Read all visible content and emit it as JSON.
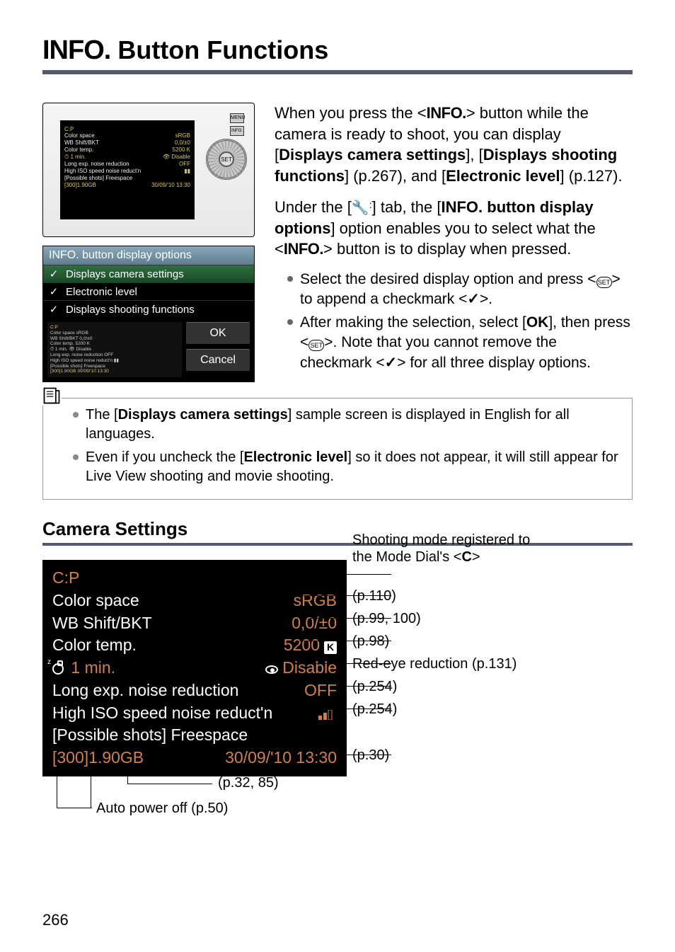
{
  "title_glyph": "INFO.",
  "title_text": "Button Functions",
  "intro": {
    "p1_a": "When you press the <",
    "p1_info": "INFO.",
    "p1_b": "> button while the camera is ready to shoot, you can display [",
    "p1_bold1": "Displays camera settings",
    "p1_c": "], [",
    "p1_bold2": "Displays shooting functions",
    "p1_d": "] (p.267), and [",
    "p1_bold3": "Electronic level",
    "p1_e": "] (p.127).",
    "p2_a": "Under the [",
    "p2_wrench": "🔧",
    "p2_b": "] tab, the [",
    "p2_bold1": "INFO. button display options",
    "p2_c": "] option enables you to select what the <",
    "p2_info": "INFO.",
    "p2_d": "> button is to display when pressed."
  },
  "bullets": [
    {
      "a": "Select the desired display option and press <",
      "mid": "SET",
      "b": "> to append a checkmark <",
      "chk": "✓",
      "c": ">."
    },
    {
      "a": "After making the selection, select [",
      "bold": "OK",
      "b": "], then press <",
      "mid": "SET",
      "c": ">. Note that you cannot remove the checkmark <",
      "chk": "✓",
      "d": "> for all three display options."
    }
  ],
  "camera_lcd": {
    "title": "C:P",
    "rows": [
      [
        "Color space",
        "sRGB"
      ],
      [
        "WB Shift/BKT",
        "0,0/±0"
      ],
      [
        "Color temp.",
        "5200  K"
      ],
      [
        "⏱ 1 min.",
        "👁 Disable"
      ],
      [
        "Long exp. noise reduction",
        "OFF"
      ],
      [
        "High ISO speed noise reduct'n",
        "▮▮"
      ],
      [
        "[Possible shots] Freespace",
        ""
      ],
      [
        "[300]1.90GB",
        "30/09/'10 13:30"
      ]
    ]
  },
  "camera_buttons": {
    "menu": "MENU",
    "info": "INFO."
  },
  "menu": {
    "header": "INFO. button display options",
    "items": [
      {
        "check": "✓",
        "label": "Displays camera settings",
        "selected": true
      },
      {
        "check": "✓",
        "label": "Electronic level",
        "selected": false
      },
      {
        "check": "✓",
        "label": "Displays shooting functions",
        "selected": false
      }
    ],
    "preview_rows": [
      "C:P",
      "Color space        sRGB",
      "WB Shift/BKT       0,0/±0",
      "Color temp.        5200  K",
      "⏱ 1 min.         👁 Disable",
      "Long exp. noise reduction   OFF",
      "High ISO speed noise reduct'n ▮▮",
      "[Possible shots] Freespace",
      "[300]1.90GB    30/09/'10 13:30"
    ],
    "ok": "OK",
    "cancel": "Cancel"
  },
  "notes": [
    {
      "a": "The [",
      "bold": "Displays camera settings",
      "b": "] sample screen is displayed in English for all languages."
    },
    {
      "a": "Even if you uncheck the [",
      "bold": "Electronic level",
      "b": "] so it does not appear, it will still appear for Live View shooting and movie shooting."
    }
  ],
  "section_heading": "Camera Settings",
  "settings": {
    "mode": "C:P",
    "rows": {
      "color_space": {
        "label": "Color space",
        "value": "sRGB"
      },
      "wb": {
        "label": "WB Shift/BKT",
        "value": "0,0/±0"
      },
      "ctemp": {
        "label": "Color temp.",
        "value": "5200",
        "suffix": "K"
      },
      "apo": {
        "label": "1 min.",
        "value": "Disable"
      },
      "long": {
        "label": "Long exp. noise reduction",
        "value": "OFF"
      },
      "high": {
        "label": "High ISO speed noise reduct'n"
      },
      "possible": {
        "label": "[Possible shots] Freespace"
      },
      "bottom": {
        "shots": "[300]1.90GB",
        "date": "30/09/'10 13:30"
      }
    }
  },
  "callouts": {
    "top_a": "Shooting mode registered to",
    "top_b": "the Mode Dial's <",
    "top_c": ">",
    "c_glyph": "C",
    "p110": "(p.110)",
    "p99": "(p.99, 100)",
    "p98": "(p.98)",
    "redeye": "Red-eye reduction (p.131)",
    "p254a": "(p.254)",
    "p254b": "(p.254)",
    "p30": "(p.30)",
    "p32": "(p.32, 85)",
    "apo": "Auto power off (p.50)"
  },
  "page_number": "266"
}
